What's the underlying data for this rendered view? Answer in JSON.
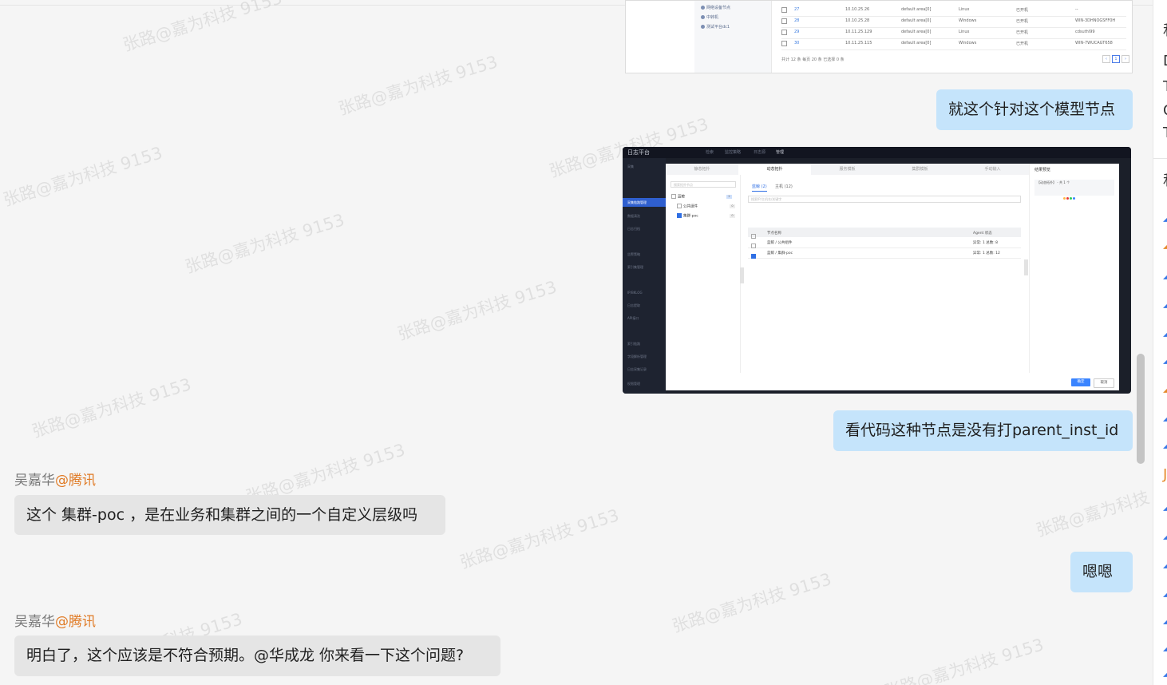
{
  "messages": [
    {
      "side": "mine",
      "text": "就这个针对这个模型节点"
    },
    {
      "side": "mine",
      "text": "看代码这种节点是没有打parent_inst_id"
    },
    {
      "side": "theirs",
      "sender": "吴嘉华",
      "org": "@腾讯",
      "text": "这个  集群-poc ，是在业务和集群之间的一个自定义层级吗"
    },
    {
      "side": "mine",
      "text": "嗯嗯"
    },
    {
      "side": "theirs",
      "sender": "吴嘉华",
      "org": "@腾讯",
      "text": "明白了，这个应该是不符合预期。@华成龙  你来看一下这个问题?"
    }
  ],
  "watermark": "张路@嘉为科技 9153",
  "colors": {
    "my_bubble": "#c5e4fb",
    "their_bubble": "#e5e5e5",
    "org_text": "#e07b26",
    "sender_text": "#777777",
    "chat_background": "#f5f5f5"
  },
  "screenshot1": {
    "tree_items": [
      "网络设备节点",
      "中转机",
      "测试平台dc1"
    ],
    "rows": [
      {
        "num": "27",
        "ip": "10.10.25.26",
        "area": "default area[0]",
        "os": "Linux",
        "status": "已开机",
        "name": "--"
      },
      {
        "num": "28",
        "ip": "10.10.25.28",
        "area": "default area[0]",
        "os": "Windows",
        "status": "已开机",
        "name": "WIN-3DHNOGSFF0H"
      },
      {
        "num": "29",
        "ip": "10.11.25.129",
        "area": "default area[0]",
        "os": "Linux",
        "status": "已开机",
        "name": "cdsuthl99"
      },
      {
        "num": "30",
        "ip": "10.11.25.115",
        "area": "default area[0]",
        "os": "Windows",
        "status": "已开机",
        "name": "WIN-7WUCAGT658"
      }
    ],
    "footer": "共计 12 条  每页  20  条  已选择 0 条",
    "page": "1"
  },
  "screenshot2": {
    "app_name": "日志平台",
    "top_nav": [
      "检索",
      "监控策略",
      "日志源",
      "管理"
    ],
    "sidebar_items": [
      "采集",
      "采集链路管理",
      "数据清洗",
      "日志归档",
      "告警策略",
      "索引集管理",
      "IP/BKLOG",
      "日志提取",
      "API接口",
      "索引链路",
      "字段解析管理",
      "日志采集记录",
      "权限管理"
    ],
    "modal_tabs": [
      "静态拓扑",
      "动态拓扑",
      "服务模板",
      "集群模板",
      "手动输入"
    ],
    "search_placeholder": "搜索拓扑节点",
    "tree_nodes": [
      {
        "label": "蓝鲸",
        "count": "2"
      },
      {
        "label": "公共组件",
        "count": "0"
      },
      {
        "label": "集群-poc",
        "count": "0"
      }
    ],
    "subtabs": [
      "蓝鲸 (2)",
      "主机 (12)"
    ],
    "subsearch_placeholder": "搜索IP/主机名/关键字",
    "table_headers": [
      "节点名称",
      "Agent 状态"
    ],
    "table_rows": [
      {
        "name": "蓝鲸 / 公共组件",
        "status": "异常: 1  总数: 8"
      },
      {
        "name": "蓝鲸 / 集群-poc",
        "status": "异常: 1  总数: 12"
      }
    ],
    "result_title": "结果预览",
    "result_item": "【动态拓扑】 - 共 1 个",
    "ok_label": "确定",
    "cancel_label": "取消",
    "status_dots": [
      "#ffb848",
      "#ea3636",
      "#2dcb56",
      "#3a84ff"
    ]
  },
  "right_panel_glyphs": [
    "和",
    "D",
    "T",
    "C",
    "T",
    "和",
    "J"
  ]
}
